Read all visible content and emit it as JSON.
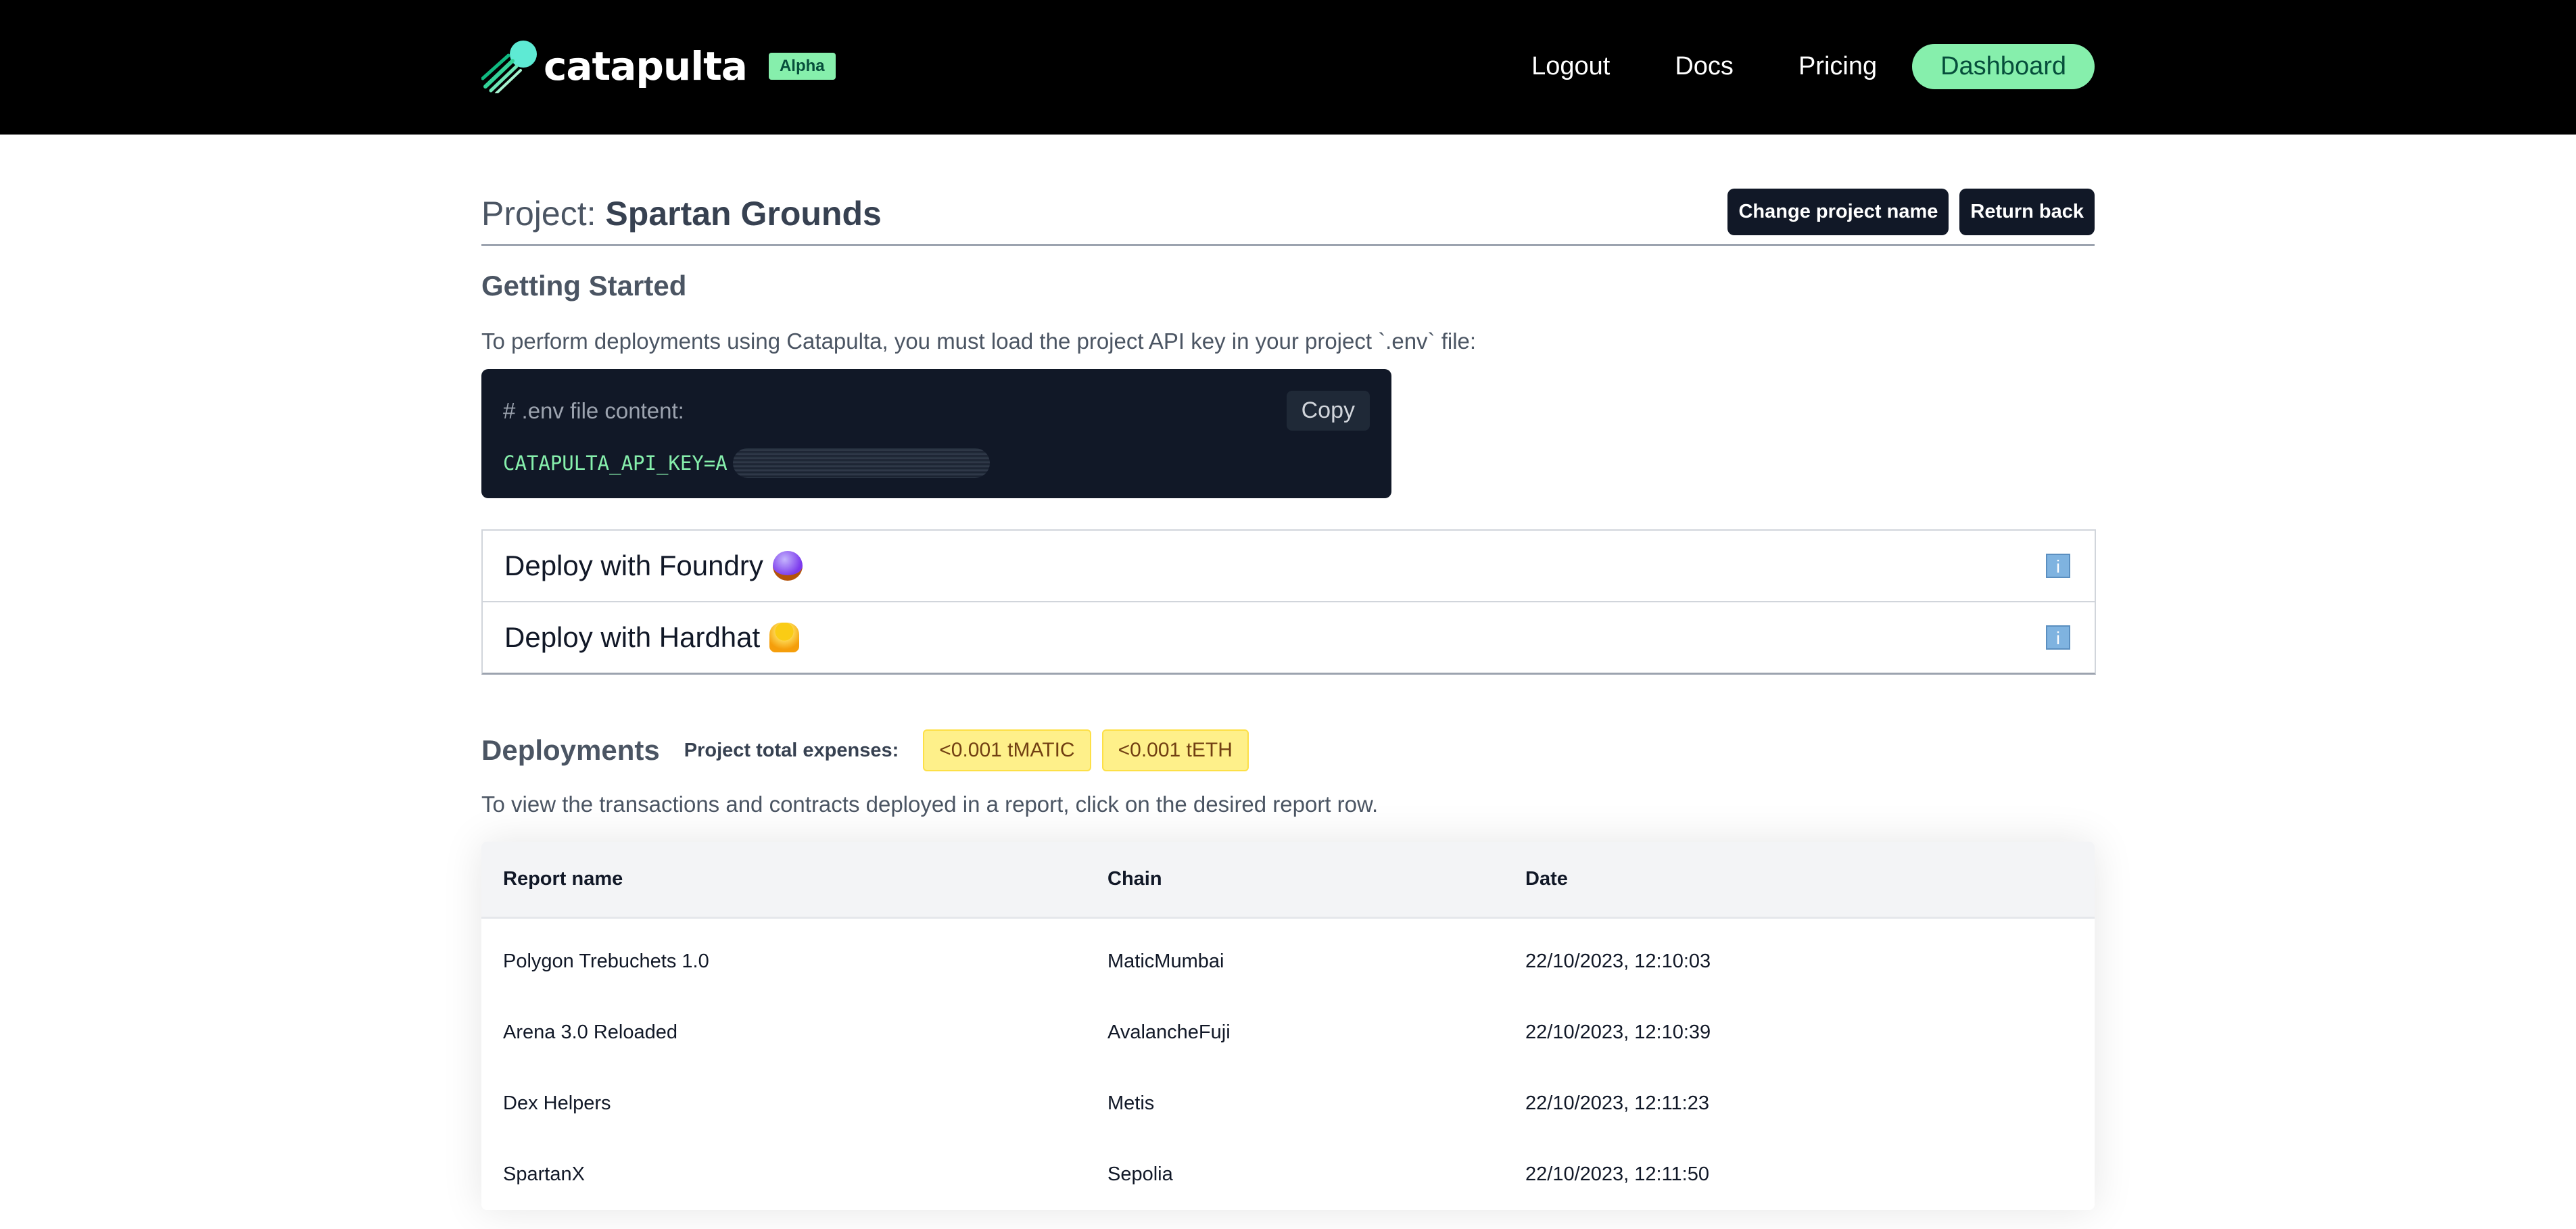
{
  "header": {
    "brand": "catapulta",
    "badge": "Alpha",
    "nav": {
      "logout": "Logout",
      "docs": "Docs",
      "pricing": "Pricing",
      "dashboard": "Dashboard"
    }
  },
  "project": {
    "label": "Project:",
    "name": "Spartan Grounds",
    "change_name_button": "Change project name",
    "return_button": "Return back"
  },
  "getting_started": {
    "title": "Getting Started",
    "description": "To perform deployments using Catapulta, you must load the project API key in your project `.env` file:",
    "code_comment": "# .env file content:",
    "code_key": "CATAPULTA_API_KEY=A",
    "copy_button": "Copy"
  },
  "accordion": [
    {
      "label": "Deploy with Foundry",
      "icon": "crystal-ball-icon",
      "info": "i"
    },
    {
      "label": "Deploy with Hardhat",
      "icon": "construction-worker-icon",
      "info": "i"
    }
  ],
  "deployments": {
    "title": "Deployments",
    "expenses_label": "Project total expenses:",
    "expenses": [
      "<0.001 tMATIC",
      "<0.001 tETH"
    ],
    "description": "To view the transactions and contracts deployed in a report, click on the desired report row.",
    "columns": [
      "Report name",
      "Chain",
      "Date"
    ],
    "rows": [
      [
        "Polygon Trebuchets 1.0",
        "MaticMumbai",
        "22/10/2023, 12:10:03"
      ],
      [
        "Arena 3.0 Reloaded",
        "AvalancheFuji",
        "22/10/2023, 12:10:39"
      ],
      [
        "Dex Helpers",
        "Metis",
        "22/10/2023, 12:11:23"
      ],
      [
        "SpartanX",
        "Sepolia",
        "22/10/2023, 12:11:50"
      ]
    ]
  },
  "colors": {
    "accent": "#86efac",
    "dark": "#111827",
    "badge_yellow": "#fef08a"
  }
}
